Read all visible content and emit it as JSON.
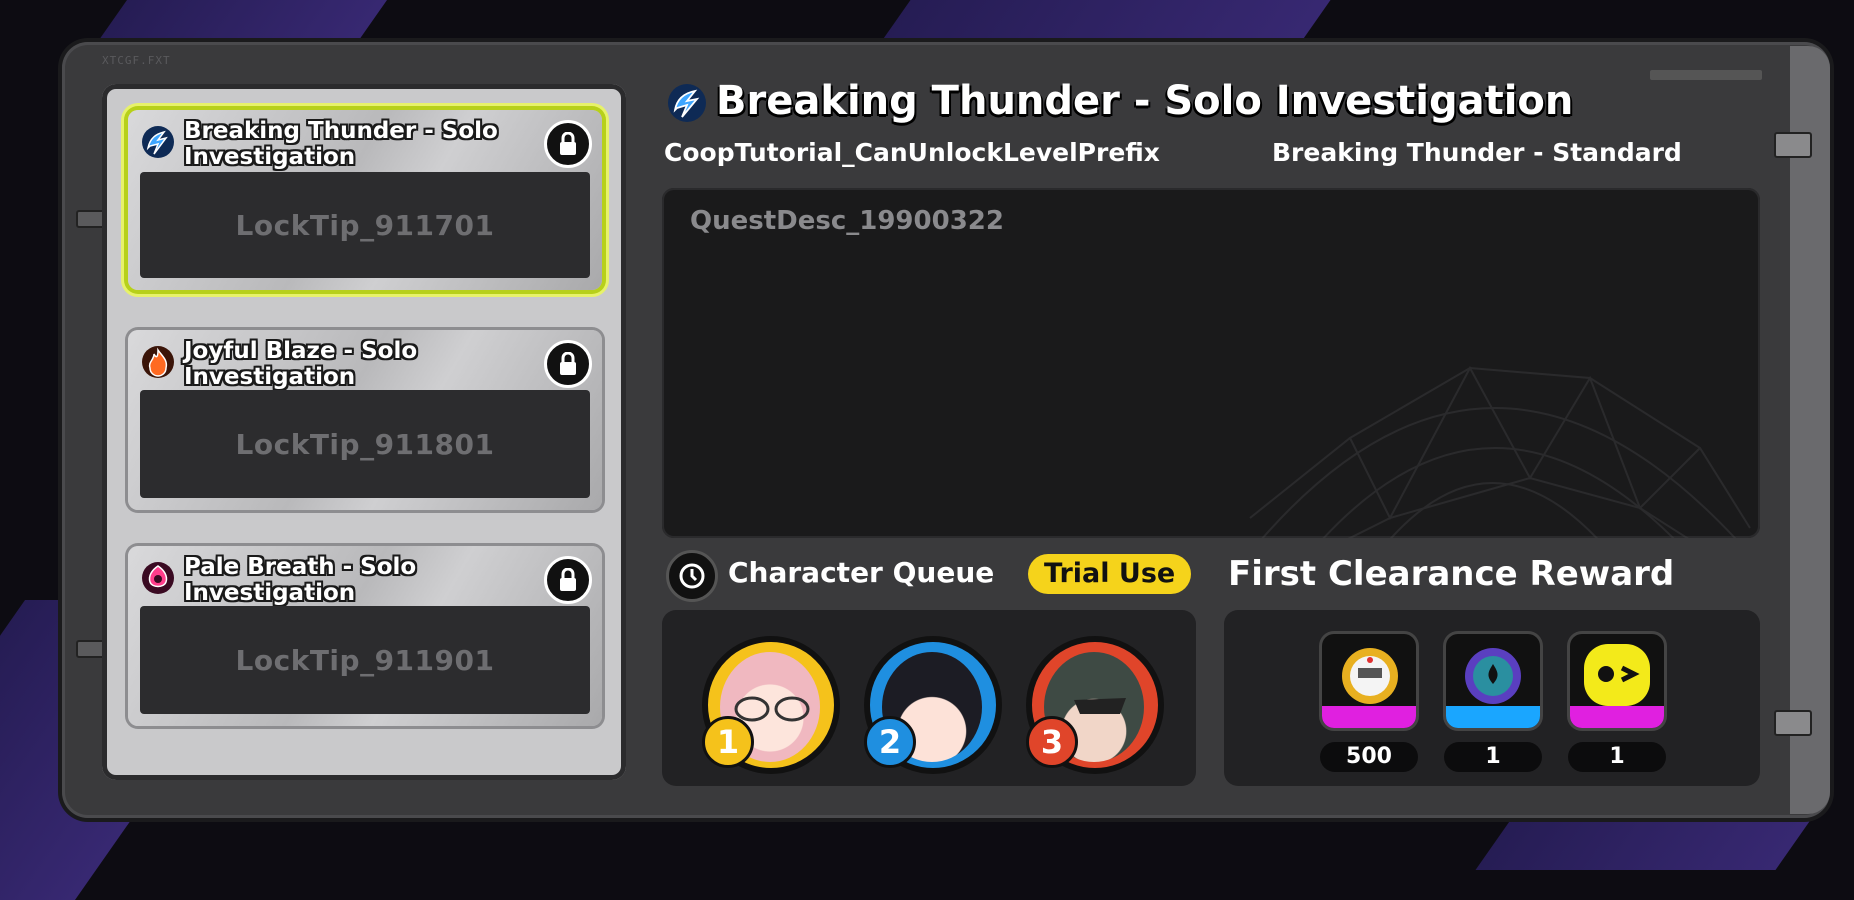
{
  "frame": {
    "tag": "XTCGF.FXT"
  },
  "quest_list": [
    {
      "title": "Breaking Thunder - Solo Investigation",
      "lock_tip": "LockTip_911701",
      "element_icon": "thunder-icon",
      "element_color": "#3ea6ff",
      "selected": true
    },
    {
      "title": "Joyful Blaze - Solo Investigation",
      "lock_tip": "LockTip_911801",
      "element_icon": "fire-icon",
      "element_color": "#ff6a22",
      "selected": false
    },
    {
      "title": "Pale Breath - Solo Investigation",
      "lock_tip": "LockTip_911901",
      "element_icon": "ether-icon",
      "element_color": "#ff3d8b",
      "selected": false
    }
  ],
  "detail": {
    "title": "Breaking Thunder - Solo Investigation",
    "unlock_prefix": "CoopTutorial_CanUnlockLevelPrefix",
    "difficulty": "Breaking Thunder - Standard",
    "description": "QuestDesc_19900322"
  },
  "queue": {
    "label": "Character Queue",
    "badge": "Trial Use",
    "characters": [
      {
        "slot": "1",
        "ring_color": "#f5c21b"
      },
      {
        "slot": "2",
        "ring_color": "#1f8fe0"
      },
      {
        "slot": "3",
        "ring_color": "#e0452a"
      }
    ]
  },
  "rewards": {
    "label": "First Clearance Reward",
    "items": [
      {
        "icon": "gear-coin-icon",
        "count": "500",
        "band_color": "#e020e0"
      },
      {
        "icon": "ether-orb-icon",
        "count": "1",
        "band_color": "#1aa6ff"
      },
      {
        "icon": "bangboo-face-icon",
        "count": "1",
        "band_color": "#e020e0"
      }
    ]
  },
  "colors": {
    "accent_selected": "#b7d01a",
    "trial_badge": "#f5d31b"
  }
}
